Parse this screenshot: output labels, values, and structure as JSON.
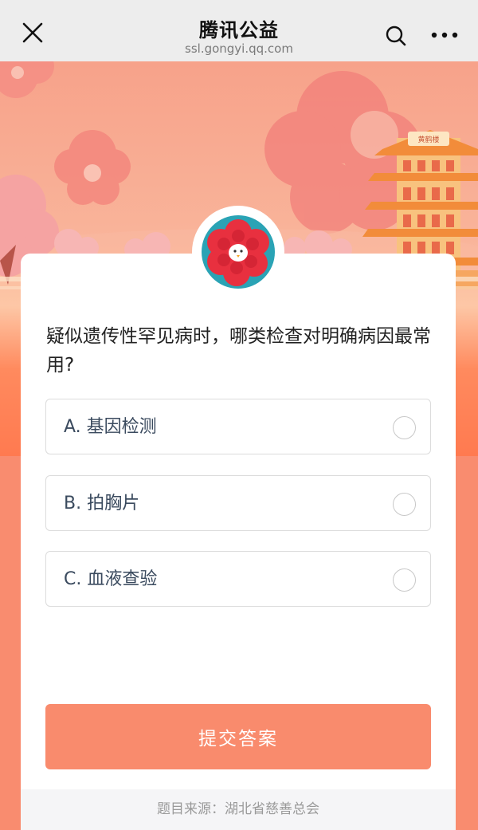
{
  "navbar": {
    "title": "腾讯公益",
    "subtitle": "ssl.gongyi.qq.com",
    "close_icon": "close-icon",
    "search_icon": "search-icon",
    "more_icon": "more-icon"
  },
  "hero": {
    "tower_sign": "黄鹤楼"
  },
  "quiz": {
    "question": "疑似遗传性罕见病时，哪类检查对明确病因最常用?",
    "options": [
      {
        "label": "A. 基因检测",
        "selected": false
      },
      {
        "label": "B. 拍胸片",
        "selected": false
      },
      {
        "label": "C. 血液查验",
        "selected": false
      }
    ],
    "submit_label": "提交答案",
    "source": "题目来源：湖北省慈善总会"
  },
  "colors": {
    "accent": "#f98b6d",
    "background_lower": "#f98c6f",
    "navbar_bg": "#ededed",
    "avatar_bg": "#2aa3b5",
    "flower_red": "#e8303f"
  }
}
